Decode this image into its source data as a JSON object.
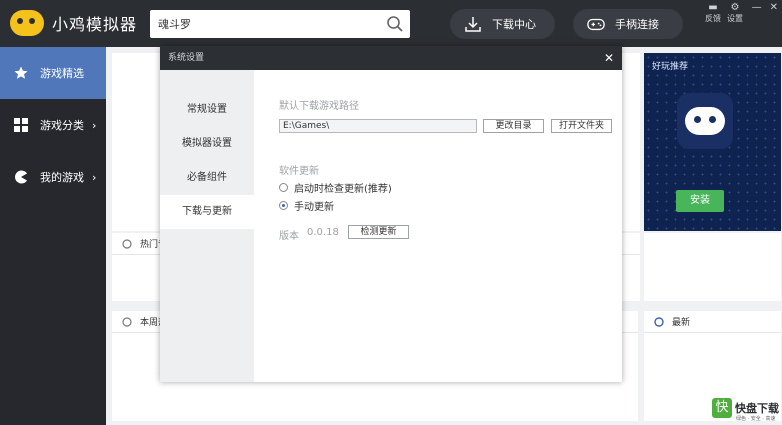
{
  "app": {
    "name": "小鸡模拟器",
    "brand_color": "#f4c21a"
  },
  "search": {
    "value": "魂斗罗",
    "icon": "search-icon"
  },
  "header": {
    "download_center": "下载中心",
    "gamepad_connect": "手柄连接",
    "feedback": "反馈",
    "settings": "设置"
  },
  "sidebar": {
    "active_color": "#4f77ba",
    "items": [
      {
        "label": "游戏精选",
        "icon": "star-icon"
      },
      {
        "label": "游戏分类",
        "icon": "grid-icon"
      },
      {
        "label": "我的游戏",
        "icon": "pacman-icon"
      }
    ]
  },
  "ad": {
    "title": "好玩推荐",
    "install": "安装"
  },
  "cards": {
    "hot": "热门专",
    "week": "本周热",
    "new": "最新"
  },
  "dialog": {
    "title": "系统设置",
    "nav": [
      "常规设置",
      "模拟器设置",
      "必备组件",
      "下载与更新"
    ],
    "download_path_label": "默认下载游戏路径",
    "download_path": "E:\\Games\\",
    "change_dir": "更改目录",
    "open_folder": "打开文件夹",
    "update_label": "软件更新",
    "update_options": [
      "启动时检查更新(推荐)",
      "手动更新"
    ],
    "selected_option": "手动更新",
    "version_label": "版本",
    "version": "0.0.18",
    "check_update": "检测更新"
  },
  "watermark": {
    "brand": "快盘下载",
    "sub": "绿色 · 安全 · 高速"
  }
}
